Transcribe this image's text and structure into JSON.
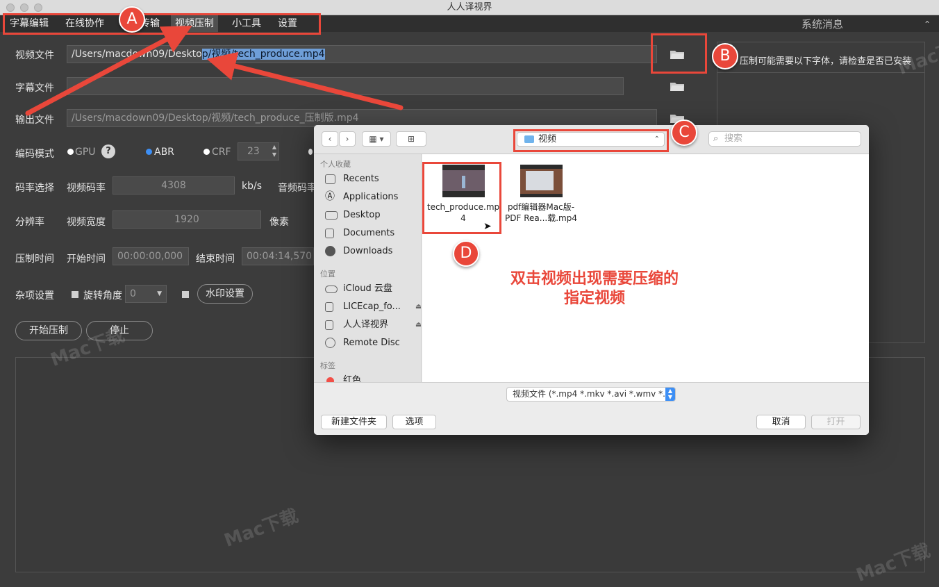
{
  "window": {
    "title": "人人译视界"
  },
  "menu": {
    "items": [
      "字幕编辑",
      "在线协作",
      "传输",
      "视频压制",
      "小工具",
      "设置"
    ]
  },
  "system": {
    "title": "系统消息",
    "message": "压制可能需要以下字体，请检查是否已安装"
  },
  "form": {
    "video_file_label": "视频文件",
    "video_file_prefix": "/Users/macdown09/Deskto",
    "video_file_selected": "p/视频/tech_produce.mp4",
    "subtitle_file_label": "字幕文件",
    "subtitle_file_value": "",
    "output_file_label": "输出文件",
    "output_file_value": "/Users/macdown09/Desktop/视频/tech_produce_压制版.mp4",
    "encode_mode_label": "编码模式",
    "gpu_label": "GPU",
    "abr_label": "ABR",
    "crf_label": "CRF",
    "crf_value": "23",
    "bitrate_label": "码率选择",
    "video_bitrate_label": "视频码率",
    "video_bitrate_value": "4308",
    "bitrate_unit": "kb/s",
    "audio_bitrate_label": "音频码率",
    "resolution_label": "分辨率",
    "video_width_label": "视频宽度",
    "video_width_value": "1920",
    "pixel_unit": "像素",
    "time_label": "压制时间",
    "start_time_label": "开始时间",
    "start_time_value": "00:00:00,000",
    "end_time_label": "结束时间",
    "end_time_value": "00:04:14,570",
    "misc_label": "杂项设置",
    "rotate_label": "旋转角度",
    "rotate_value": "0",
    "watermark_button": "水印设置",
    "start_button": "开始压制",
    "stop_button": "停止"
  },
  "dialog": {
    "location": "视频",
    "search_placeholder": "搜索",
    "sidebar": {
      "favorites_header": "个人收藏",
      "favorites": [
        "Recents",
        "Applications",
        "Desktop",
        "Documents",
        "Downloads"
      ],
      "locations_header": "位置",
      "locations": [
        "iCloud 云盘",
        "LICEcap_fo...",
        "人人译视界",
        "Remote Disc"
      ],
      "tags_header": "标签",
      "tags": [
        "红色"
      ]
    },
    "files": [
      {
        "name_line1": "tech_produce.mp",
        "name_line2": "4"
      },
      {
        "name_line1": "pdf编辑器Mac版-",
        "name_line2": "PDF Rea...载.mp4"
      }
    ],
    "filter": "视频文件 (*.mp4 *.mkv *.avi *.wmv *...",
    "new_folder_button": "新建文件夹",
    "options_button": "选项",
    "cancel_button": "取消",
    "open_button": "打开"
  },
  "annotations": {
    "badges": [
      "A",
      "B",
      "C",
      "D"
    ],
    "note_line1": "双击视频出现需要压缩的",
    "note_line2": "指定视频",
    "color": "#e9473a"
  },
  "watermark": {
    "text": "Mac下载"
  }
}
